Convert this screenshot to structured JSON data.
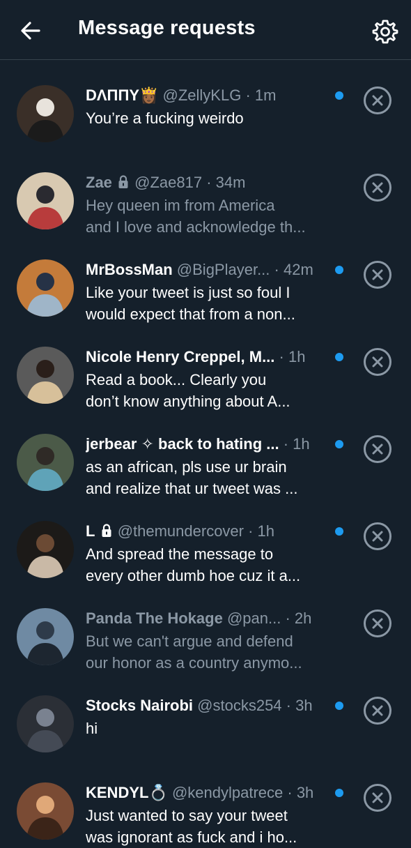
{
  "header": {
    "title": "Message requests",
    "back_icon": "arrow-left-icon",
    "settings_icon": "gear-icon"
  },
  "colors": {
    "background": "#15202b",
    "unread_dot": "#1d9bf0",
    "muted_text": "#8b98a5"
  },
  "requests": [
    {
      "name": "DΛΠΠY👸🏾",
      "handle": "@ZellyKLG",
      "time": "· 1m",
      "message": "You’re a fucking weirdo",
      "unread": true,
      "locked": false
    },
    {
      "name": "Zae",
      "handle": "@Zae817",
      "time": "· 34m",
      "message": "Hey queen im from America\nand I love and acknowledge th...",
      "unread": false,
      "locked": true
    },
    {
      "name": "MrBossMan",
      "handle": "@BigPlayer...",
      "time": "· 42m",
      "message": "Like your tweet is just so foul I\nwould expect that from a non...",
      "unread": true,
      "locked": false
    },
    {
      "name": "Nicole Henry Creppel, M...",
      "handle": "",
      "time": "· 1h",
      "message": "Read a book...  Clearly you\ndon’t know anything about A...",
      "unread": true,
      "locked": false
    },
    {
      "name": "jerbear ✧ back to hating ...",
      "handle": "",
      "time": "· 1h",
      "message": "as an african, pls use ur brain\nand realize that ur tweet was ...",
      "unread": true,
      "locked": false
    },
    {
      "name": "L",
      "handle": "@themundercover",
      "time": "· 1h",
      "message": "And spread the message to\nevery other dumb hoe cuz it a...",
      "unread": true,
      "locked": true
    },
    {
      "name": "Panda The Hokage",
      "handle": "@pan...",
      "time": "· 2h",
      "message": "But we can't argue and defend\nour honor as a country anymo...",
      "unread": false,
      "locked": false
    },
    {
      "name": "Stocks Nairobi",
      "handle": "@stocks254",
      "time": "· 3h",
      "message": "hi",
      "unread": true,
      "locked": false
    },
    {
      "name": "KENDYL💍",
      "handle": "@kendylpatrece",
      "time": "· 3h",
      "message": "Just wanted to say your tweet\nwas ignorant as fuck and i ho...",
      "unread": true,
      "locked": false
    }
  ]
}
